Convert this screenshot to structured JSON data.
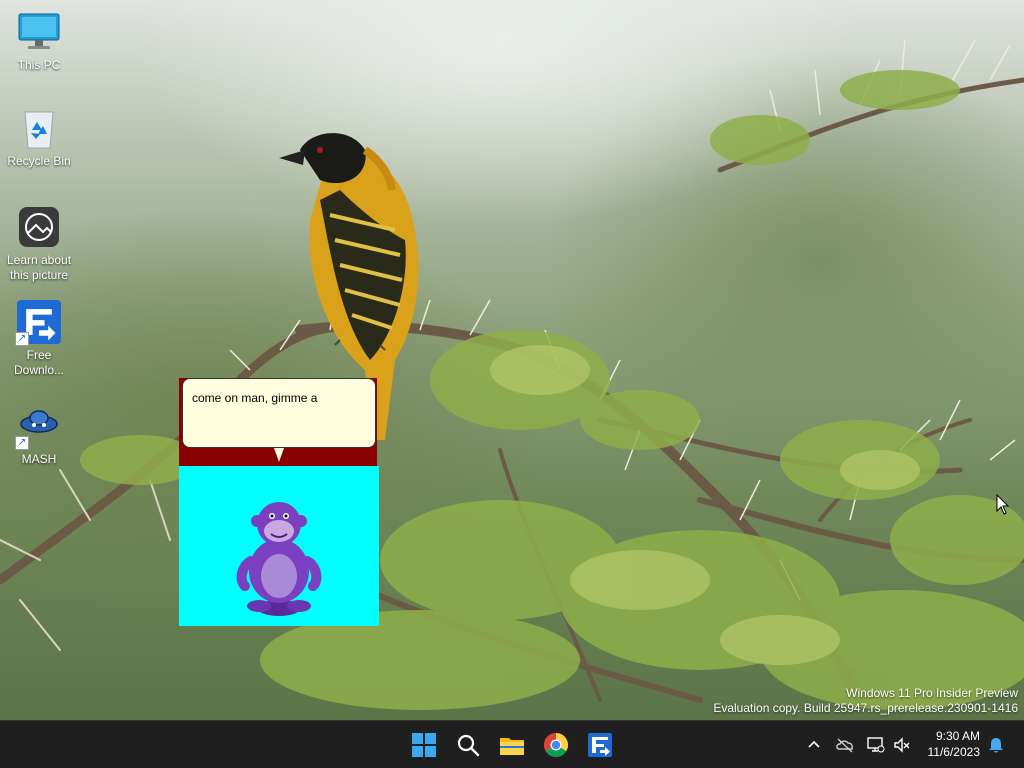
{
  "desktop": {
    "icons": [
      {
        "label": "This PC",
        "icon": "this-pc-icon"
      },
      {
        "label": "Recycle Bin",
        "icon": "recycle-bin-icon"
      },
      {
        "label": "Learn about this picture",
        "icon": "learn-picture-icon"
      },
      {
        "label": "Free Downlo...",
        "icon": "free-download-manager-icon"
      },
      {
        "label": "MASH",
        "icon": "mash-icon"
      }
    ]
  },
  "bonzi": {
    "speech": "come on man, gimme a"
  },
  "watermark": {
    "line1": "Windows 11 Pro Insider Preview",
    "line2": "Evaluation copy. Build 25947.rs_prerelease.230901-1416"
  },
  "taskbar": {
    "apps": [
      "start-icon",
      "search-icon",
      "file-explorer-icon",
      "chrome-icon",
      "free-download-manager-icon"
    ],
    "clock": {
      "time": "9:30 AM",
      "date": "11/6/2023"
    }
  },
  "colors": {
    "taskbar": "#1f1f1f",
    "bonzi_stage": "#00ffff",
    "bonzi_header": "#8b0000",
    "bubble": "#ffffdf",
    "accent": "#0078d4"
  }
}
